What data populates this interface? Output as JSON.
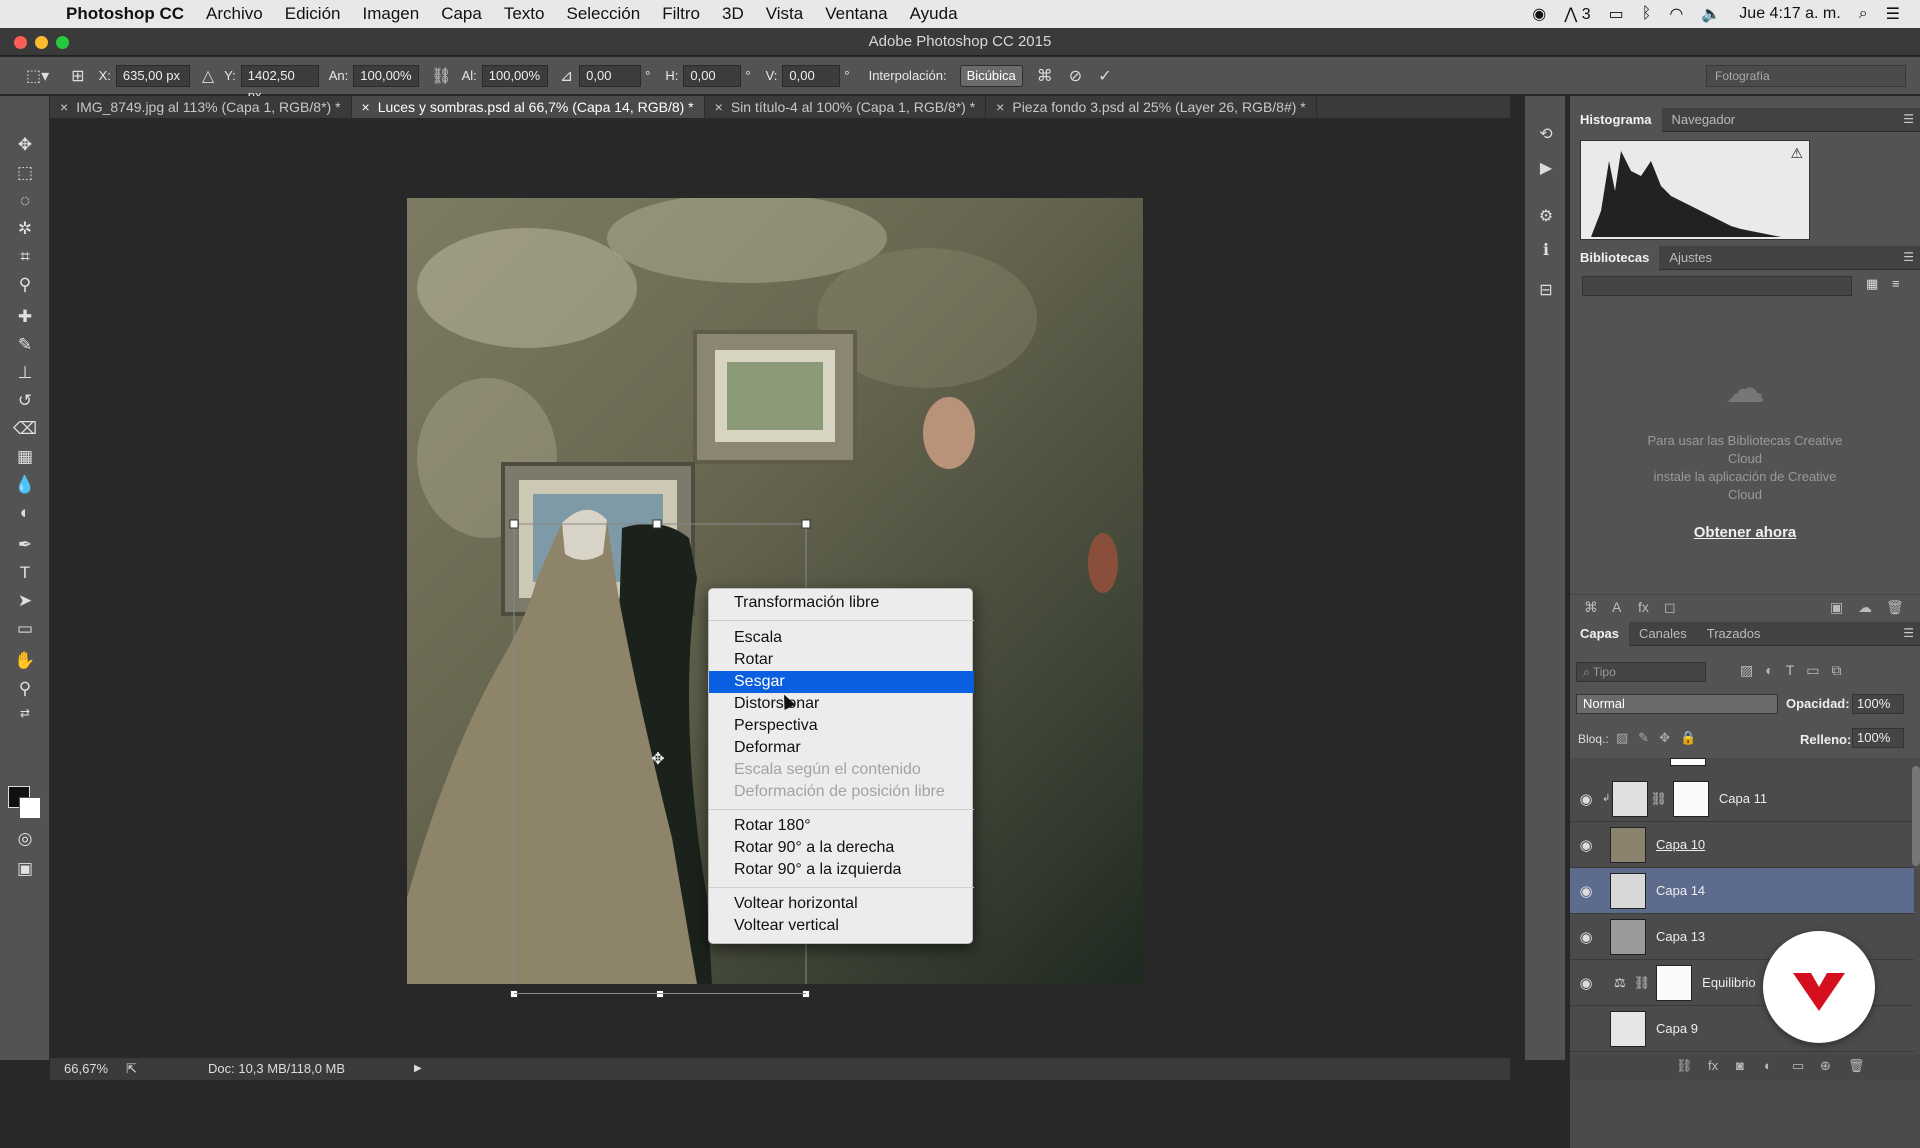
{
  "menubar": {
    "app": "Photoshop CC",
    "items": [
      "Archivo",
      "Edición",
      "Imagen",
      "Capa",
      "Texto",
      "Selección",
      "Filtro",
      "3D",
      "Vista",
      "Ventana",
      "Ayuda"
    ],
    "adobe_badge": "3",
    "clock": "Jue 4:17 a. m."
  },
  "window": {
    "title": "Adobe Photoshop CC 2015"
  },
  "options": {
    "x_label": "X:",
    "x_value": "635,00 px",
    "y_label": "Y:",
    "y_value": "1402,50 px",
    "w_label": "An:",
    "w_value": "100,00%",
    "h_label": "Al:",
    "h_value": "100,00%",
    "angle_value": "0,00",
    "hskew_label": "H:",
    "hskew_value": "0,00",
    "vskew_label": "V:",
    "vskew_value": "0,00",
    "degree_unit": "°",
    "interp_label": "Interpolación:",
    "interp_value": "Bicúbica",
    "workspace": "Fotografía"
  },
  "tabs": [
    {
      "label": "IMG_8749.jpg al 113% (Capa 1, RGB/8*) *"
    },
    {
      "label": "Luces y sombras.psd al 66,7% (Capa 14, RGB/8) *"
    },
    {
      "label": "Sin título-4 al 100% (Capa 1, RGB/8*) *"
    },
    {
      "label": "Pieza fondo 3.psd al 25% (Layer 26, RGB/8#) *"
    }
  ],
  "context_menu": {
    "items": [
      {
        "label": "Transformación libre"
      },
      {
        "label": "Escala"
      },
      {
        "label": "Rotar"
      },
      {
        "label": "Sesgar",
        "highlighted": true
      },
      {
        "label": "Distorsionar"
      },
      {
        "label": "Perspectiva"
      },
      {
        "label": "Deformar"
      },
      {
        "label": "Escala según el contenido",
        "disabled": true
      },
      {
        "label": "Deformación de posición libre",
        "disabled": true
      },
      {
        "label": "Rotar 180°"
      },
      {
        "label": "Rotar 90° a la derecha"
      },
      {
        "label": "Rotar 90° a la izquierda"
      },
      {
        "label": "Voltear horizontal"
      },
      {
        "label": "Voltear vertical"
      }
    ]
  },
  "status": {
    "zoom": "66,67%",
    "doc": "Doc: 10,3 MB/118,0 MB"
  },
  "panels": {
    "histogram_tabs": [
      "Histograma",
      "Navegador"
    ],
    "library_tabs": [
      "Bibliotecas",
      "Ajustes"
    ],
    "library_message": [
      "Para usar las Bibliotecas Creative",
      "Cloud",
      "instale la aplicación de Creative",
      "Cloud"
    ],
    "library_link": "Obtener ahora",
    "layers_tabs": [
      "Capas",
      "Canales",
      "Trazados"
    ],
    "filter_placeholder": "Tipo",
    "blend_mode": "Normal",
    "opacity_label": "Opacidad:",
    "opacity_value": "100%",
    "lock_label": "Bloq.:",
    "fill_label": "Relleno:",
    "fill_value": "100%",
    "layers": [
      {
        "name": "Capa 11",
        "visible": true
      },
      {
        "name": "Capa 10",
        "visible": true
      },
      {
        "name": "Capa 14",
        "visible": true,
        "selected": true
      },
      {
        "name": "Capa 13",
        "visible": true
      },
      {
        "name": "Equilibrio",
        "visible": true
      },
      {
        "name": "Capa 9",
        "visible": false
      }
    ]
  },
  "colors": {
    "highlight": "#0a5fe0",
    "layer_selected": "#5d6b8c",
    "logo_red": "#d4101e"
  }
}
